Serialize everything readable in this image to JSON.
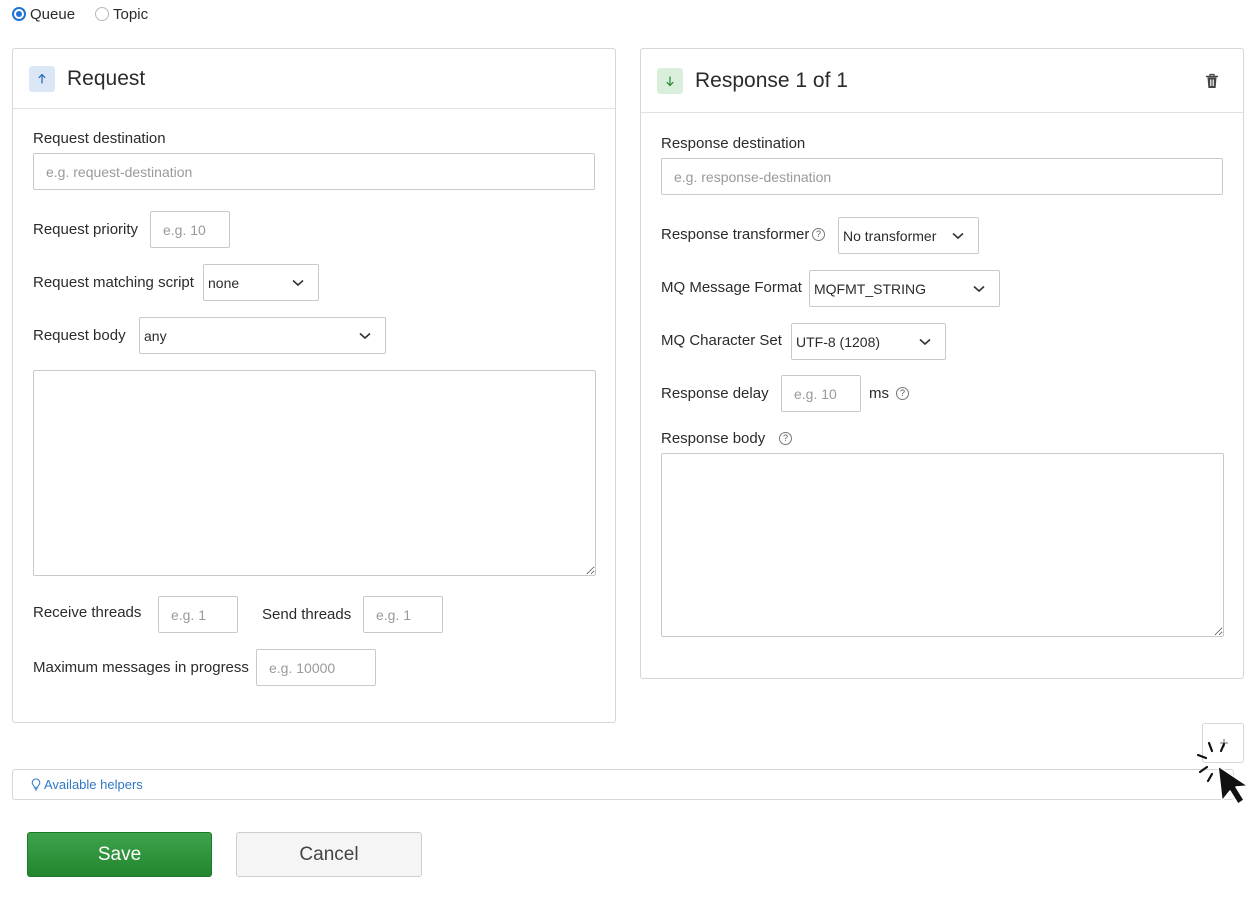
{
  "type_selector": {
    "options": [
      {
        "label": "Queue",
        "checked": true
      },
      {
        "label": "Topic",
        "checked": false
      }
    ]
  },
  "request": {
    "title": "Request",
    "icon": "arrow-up-icon",
    "destination_label": "Request destination",
    "destination_placeholder": "e.g. request-destination",
    "priority_label": "Request priority",
    "priority_placeholder": "e.g. 10",
    "matching_script_label": "Request matching script",
    "matching_script_value": "none",
    "body_label": "Request body",
    "body_value": "any",
    "body_text": "",
    "receive_threads_label": "Receive threads",
    "receive_threads_placeholder": "e.g. 1",
    "send_threads_label": "Send threads",
    "send_threads_placeholder": "e.g. 1",
    "max_messages_label": "Maximum messages in progress",
    "max_messages_placeholder": "e.g. 10000"
  },
  "response": {
    "title": "Response 1 of 1",
    "icon": "arrow-down-icon",
    "delete_icon": "trash-icon",
    "destination_label": "Response destination",
    "destination_placeholder": "e.g. response-destination",
    "transformer_label": "Response transformer",
    "transformer_value": "No transformer",
    "mq_format_label": "MQ Message Format",
    "mq_format_value": "MQFMT_STRING",
    "mq_charset_label": "MQ Character Set",
    "mq_charset_value": "UTF-8 (1208)",
    "delay_label": "Response delay",
    "delay_placeholder": "e.g. 10",
    "delay_unit": "ms",
    "body_label": "Response body",
    "body_text": ""
  },
  "helpers": {
    "label": "Available helpers",
    "icon": "lightbulb-icon"
  },
  "add_response": {
    "icon": "plus-icon"
  },
  "actions": {
    "save_label": "Save",
    "cancel_label": "Cancel"
  },
  "colors": {
    "accent_blue": "#1f73d6",
    "save_green": "#2e9a3c",
    "link_blue": "#2f78c4"
  }
}
